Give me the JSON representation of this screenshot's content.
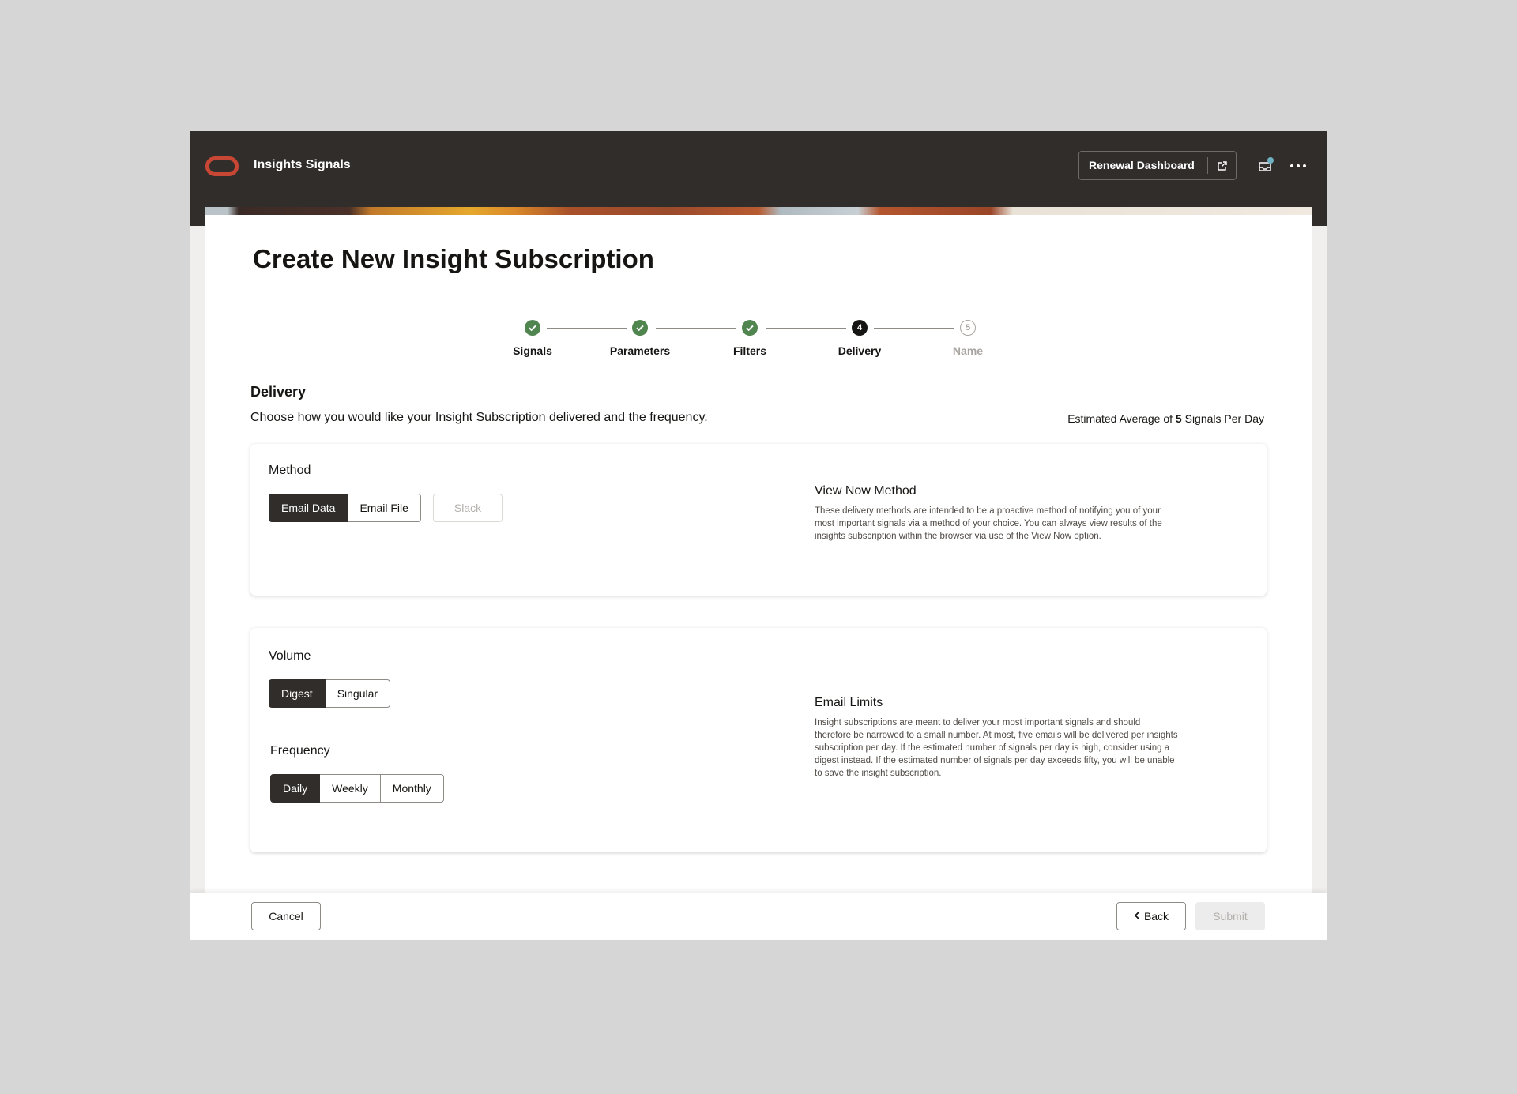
{
  "app": {
    "title": "Insights Signals"
  },
  "header": {
    "dashboard_button": "Renewal Dashboard",
    "icons": {
      "external": "external-link-icon",
      "inbox": "inbox-icon",
      "more": "more-horizontal-icon"
    }
  },
  "page": {
    "title": "Create New Insight Subscription"
  },
  "steps": [
    {
      "label": "Signals",
      "status": "done"
    },
    {
      "label": "Parameters",
      "status": "done"
    },
    {
      "label": "Filters",
      "status": "done"
    },
    {
      "label": "Delivery",
      "status": "current",
      "number": "4"
    },
    {
      "label": "Name",
      "status": "todo",
      "number": "5"
    }
  ],
  "section": {
    "title": "Delivery",
    "description": "Choose how you would like your Insight Subscription delivered and the frequency.",
    "estimate_prefix": "Estimated Average of ",
    "estimate_value": "5",
    "estimate_suffix": " Signals Per Day"
  },
  "method": {
    "label": "Method",
    "options": [
      "Email Data",
      "Email File"
    ],
    "selected": "Email Data",
    "disabled_option": "Slack",
    "info_title": "View Now Method",
    "info_text": "These delivery methods are intended to be a proactive method of notifying you of your most important signals via a method of your choice. You can always view results of the insights subscription within the browser via use of the View Now option."
  },
  "volume": {
    "label": "Volume",
    "options": [
      "Digest",
      "Singular"
    ],
    "selected": "Digest"
  },
  "frequency": {
    "label": "Frequency",
    "options": [
      "Daily",
      "Weekly",
      "Monthly"
    ],
    "selected": "Daily"
  },
  "limits": {
    "info_title": "Email Limits",
    "info_text": "Insight subscriptions are meant to deliver your most important signals and should therefore be narrowed to a small number. At most, five emails will be delivered per insights subscription per day. If the estimated number of signals per day is high, consider using a digest instead. If the estimated number of signals per day exceeds fifty, you will be unable to save the insight subscription."
  },
  "footer": {
    "cancel": "Cancel",
    "back": "Back",
    "submit": "Submit"
  },
  "colors": {
    "header_bg": "#312d2a",
    "brand": "#c74634",
    "step_done": "#508550",
    "selected": "#312d2a"
  }
}
